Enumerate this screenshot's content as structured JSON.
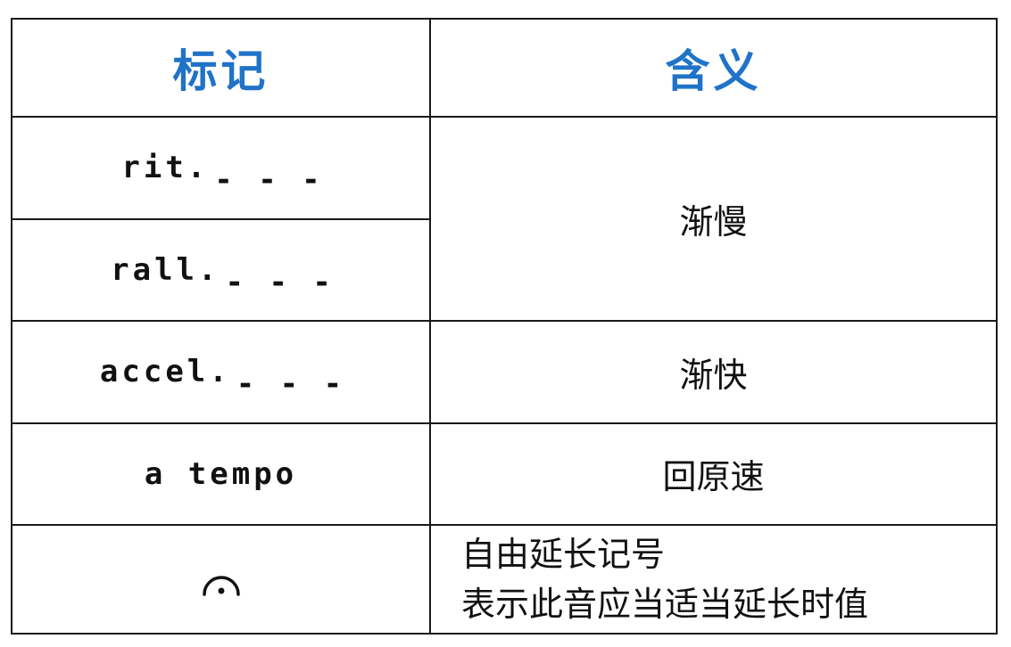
{
  "header": {
    "col1": "标记",
    "col2": "含义"
  },
  "rows": [
    {
      "mark": "rit.",
      "dashes": "- - -"
    },
    {
      "mark": "rall.",
      "dashes": "- - -"
    },
    {
      "mark": "accel.",
      "dashes": "- - -"
    },
    {
      "mark": "a tempo"
    },
    {
      "mark_icon": "fermata-icon"
    }
  ],
  "meanings": {
    "slow": "渐慢",
    "fast": "渐快",
    "tempo": "回原速",
    "fermata_line1": "自由延长记号",
    "fermata_line2": "表示此音应当适当延长时值"
  },
  "colors": {
    "header_text": "#1f73c8",
    "border": "#1a1a1a"
  }
}
